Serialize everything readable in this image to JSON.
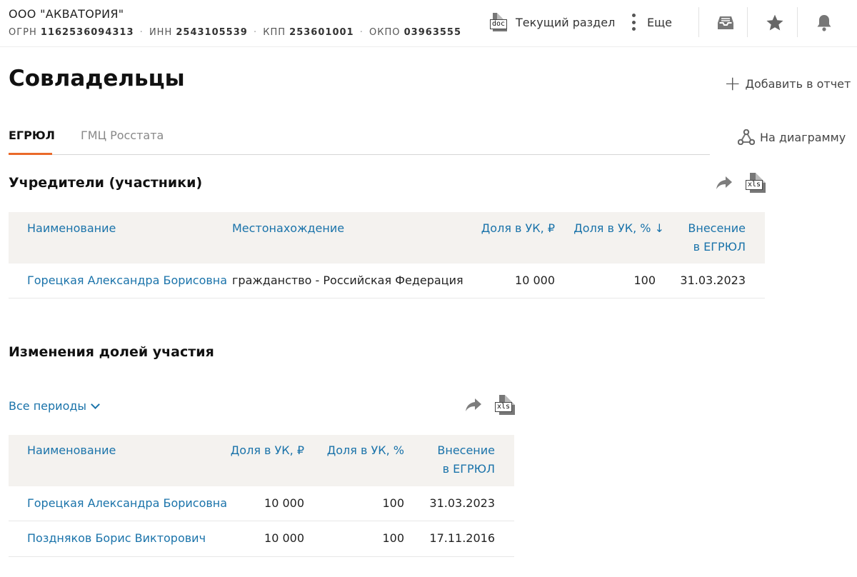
{
  "company": {
    "name": "ООО \"АКВАТОРИЯ\"",
    "ids": [
      {
        "label": "ОГРН",
        "value": "1162536094313"
      },
      {
        "label": "ИНН",
        "value": "2543105539"
      },
      {
        "label": "КПП",
        "value": "253601001"
      },
      {
        "label": "ОКПО",
        "value": "03963555"
      }
    ],
    "separator": "·"
  },
  "header": {
    "doc_icon_text": "doc",
    "current_section_label": "Текущий раздел",
    "more_label": "Еще"
  },
  "page": {
    "title": "Совладельцы",
    "add_to_report_label": "Добавить в отчет",
    "diagram_label": "На диаграмму"
  },
  "tabs": [
    {
      "label": "ЕГРЮЛ",
      "active": true
    },
    {
      "label": "ГМЦ Росстата",
      "active": false
    }
  ],
  "founders": {
    "title": "Учредители (участники)",
    "xls_text": "xls",
    "columns": {
      "name": "Наименование",
      "location": "Местонахождение",
      "share_rub": "Доля в УК, ₽",
      "share_pct": "Доля в УК, % ↓",
      "entry_l1": "Внесение",
      "entry_l2": "в ЕГРЮЛ"
    },
    "rows": [
      {
        "name": "Горецкая Александра Борисовна",
        "location": "гражданство - Российская Федерация",
        "share_rub": "10 000",
        "share_pct": "100",
        "date": "31.03.2023"
      }
    ]
  },
  "changes": {
    "title": "Изменения долей участия",
    "period_label": "Все периоды",
    "xls_text": "xls",
    "columns": {
      "name": "Наименование",
      "share_rub": "Доля в УК, ₽",
      "share_pct": "Доля в УК, %",
      "entry_l1": "Внесение",
      "entry_l2": "в ЕГРЮЛ"
    },
    "rows": [
      {
        "name": "Горецкая Александра Борисовна",
        "share_rub": "10 000",
        "share_pct": "100",
        "date": "31.03.2023"
      },
      {
        "name": "Поздняков Борис Викторович",
        "share_rub": "10 000",
        "share_pct": "100",
        "date": "17.11.2016"
      }
    ]
  },
  "colors": {
    "accent_orange": "#ea6a2a",
    "link_blue": "#1a73aa",
    "table_header_bg": "#f4f2ef"
  }
}
